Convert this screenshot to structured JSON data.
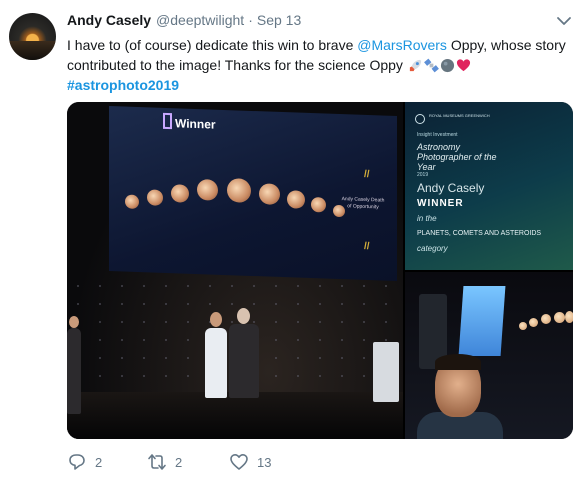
{
  "tweet": {
    "author_name": "Andy Casely",
    "handle": "@deeptwilight",
    "separator": "·",
    "time": "Sep 13",
    "text": {
      "part1": "I have to (of course) dedicate this win to brave ",
      "mention": "@MarsRovers",
      "part2": " Oppy, whose story contributed to the image!  Thanks for the science Oppy ",
      "hashtag": "#astrophoto2019"
    },
    "emoji_icons": [
      "rocket-icon",
      "satellite-icon",
      "planet-icon",
      "heart-icon"
    ]
  },
  "media": {
    "photo1": {
      "label": "Winner",
      "caption": "Andy Casely Death of Opportunity",
      "slash": "//"
    },
    "photo2": {
      "logo_text": "ROYAL MUSEUMS GREENWICH",
      "kicker": "Insight Investment",
      "title": "Astronomy Photographer of the Year",
      "year": "2019",
      "name": "Andy Casely",
      "winner": "WINNER",
      "in_the": "in the",
      "category": "PLANETS, COMETS AND ASTEROIDS",
      "category_label": "category"
    }
  },
  "actions": {
    "reply_count": "2",
    "retweet_count": "2",
    "like_count": "13"
  },
  "colors": {
    "link": "#1b95e0",
    "muted": "#657786",
    "text": "#14171a"
  }
}
